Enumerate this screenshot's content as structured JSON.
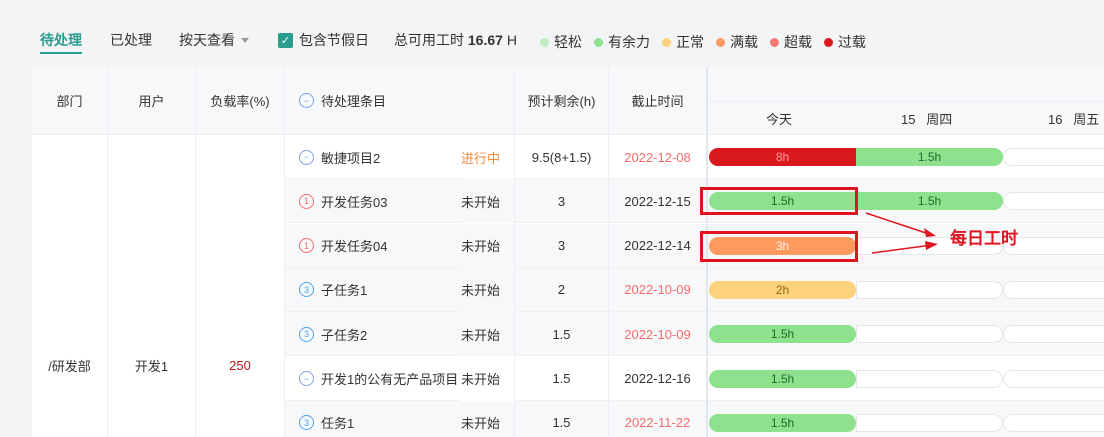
{
  "tabs": [
    "待处理",
    "已处理"
  ],
  "view_select": "按天查看",
  "holiday_checkbox": {
    "label": "包含节假日",
    "checked": true
  },
  "total_hours": {
    "label": "总可用工时",
    "value": "16.67",
    "unit": "H"
  },
  "legend": [
    {
      "label": "轻松",
      "color": "#c2ecc4"
    },
    {
      "label": "有余力",
      "color": "#8ee28e"
    },
    {
      "label": "正常",
      "color": "#fdd27a"
    },
    {
      "label": "满载",
      "color": "#ff9a5e"
    },
    {
      "label": "超载",
      "color": "#f87878"
    },
    {
      "label": "过载",
      "color": "#d9191c"
    }
  ],
  "columns": [
    "部门",
    "用户",
    "负载率(%)",
    "待处理条目",
    "预计剩余(h)",
    "截止时间"
  ],
  "days": [
    "今天",
    "15   周四",
    "16   周五"
  ],
  "group": {
    "dept": "/研发部",
    "user": "开发1",
    "load": "250"
  },
  "rows": [
    {
      "type": "project",
      "name": "敏捷项目2",
      "status": "进行中",
      "remain": "9.5(8+1.5)",
      "deadline": "2022-12-08",
      "overdue": true,
      "bars": [
        {
          "label": "8h",
          "color": "#d9191c"
        },
        {
          "label": "1.5h",
          "color": "#8ee28e"
        },
        null
      ]
    },
    {
      "type": "task",
      "priority": "1",
      "name": "开发任务03",
      "status": "未开始",
      "remain": "3",
      "deadline": "2022-12-15",
      "overdue": false,
      "bars": [
        {
          "label": "1.5h",
          "color": "#8ee28e"
        },
        {
          "label": "1.5h",
          "color": "#8ee28e"
        },
        null
      ]
    },
    {
      "type": "task",
      "priority": "1",
      "name": "开发任务04",
      "status": "未开始",
      "remain": "3",
      "deadline": "2022-12-14",
      "overdue": false,
      "bars": [
        {
          "label": "3h",
          "color": "#ff9a5e"
        },
        null,
        null
      ]
    },
    {
      "type": "task",
      "priority": "3",
      "name": "子任务1",
      "status": "未开始",
      "remain": "2",
      "deadline": "2022-10-09",
      "overdue": true,
      "bars": [
        {
          "label": "2h",
          "color": "#fdd27a"
        },
        null,
        null
      ]
    },
    {
      "type": "task",
      "priority": "3",
      "name": "子任务2",
      "status": "未开始",
      "remain": "1.5",
      "deadline": "2022-10-09",
      "overdue": true,
      "bars": [
        {
          "label": "1.5h",
          "color": "#8ee28e"
        },
        null,
        null
      ]
    },
    {
      "type": "project",
      "name": "开发1的公有无产品项目",
      "status": "未开始",
      "remain": "1.5",
      "deadline": "2022-12-16",
      "overdue": false,
      "bars": [
        {
          "label": "1.5h",
          "color": "#8ee28e"
        },
        null,
        null
      ]
    },
    {
      "type": "task",
      "priority": "3",
      "name": "任务1",
      "status": "未开始",
      "remain": "1.5",
      "deadline": "2022-11-22",
      "overdue": true,
      "bars": [
        {
          "label": "1.5h",
          "color": "#8ee28e"
        },
        null,
        null
      ]
    }
  ],
  "annotation": "每日工时"
}
